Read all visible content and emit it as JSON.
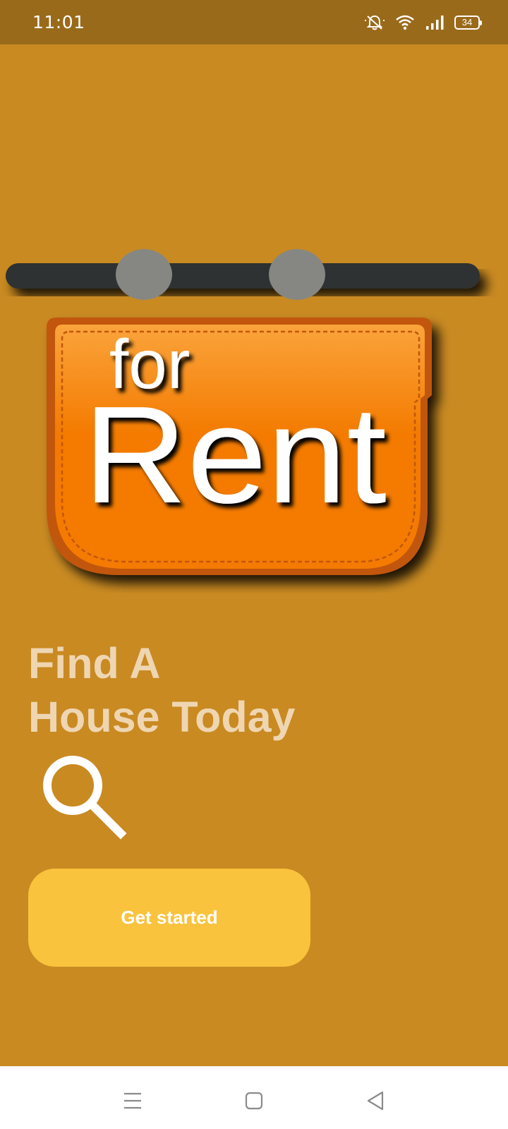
{
  "status_bar": {
    "time": "11:01",
    "battery_level": "34",
    "icons": [
      "mute-icon",
      "wifi-icon",
      "signal-icon",
      "battery-icon"
    ]
  },
  "hero": {
    "sign_top_text": "for",
    "sign_main_text": "Rent",
    "colors": {
      "sign_orange": "#f47b00",
      "sign_border": "#c2570a",
      "rod": "#2e3133",
      "ring": "#868783"
    }
  },
  "headline": {
    "line1": "Find A",
    "line2": "House Today"
  },
  "search_icon": "search-icon",
  "cta": {
    "label": "Get started",
    "color": "#f9c33d"
  },
  "nav_bar": {
    "buttons": [
      "menu-icon",
      "home-square-icon",
      "back-triangle-icon"
    ]
  },
  "colors": {
    "background": "#c98a22",
    "status_bar": "#9a6a1b",
    "headline_text": "#efd6b2"
  }
}
